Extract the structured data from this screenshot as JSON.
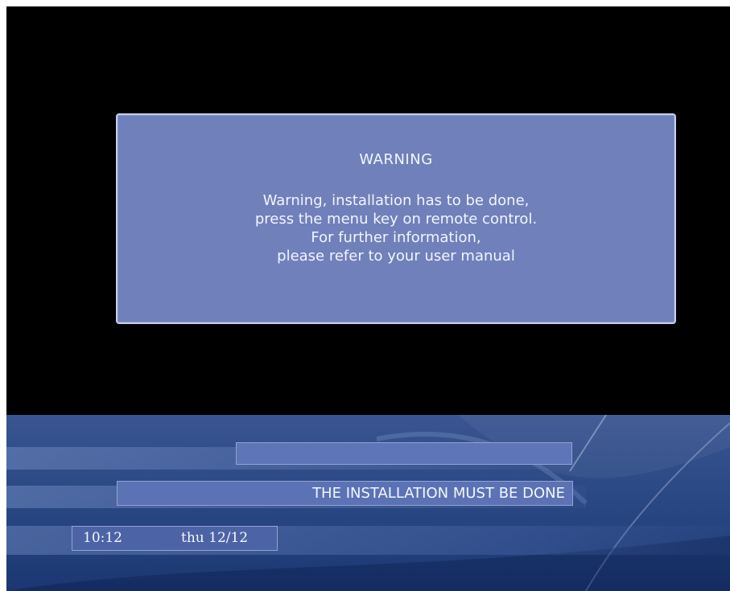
{
  "dialog": {
    "title": "WARNING",
    "lines": [
      "Warning, installation has to be done,",
      "press the menu key on remote control.",
      "For further information,",
      "please refer to your user manual"
    ]
  },
  "status_bar": {
    "message": "THE INSTALLATION MUST BE DONE",
    "time": "10:12",
    "date": "thu 12/12"
  },
  "colors": {
    "screen_background": "#000000",
    "dialog_background": "#6f80bb",
    "band_background": "#2c4a86",
    "text": "#f3f5fb"
  }
}
